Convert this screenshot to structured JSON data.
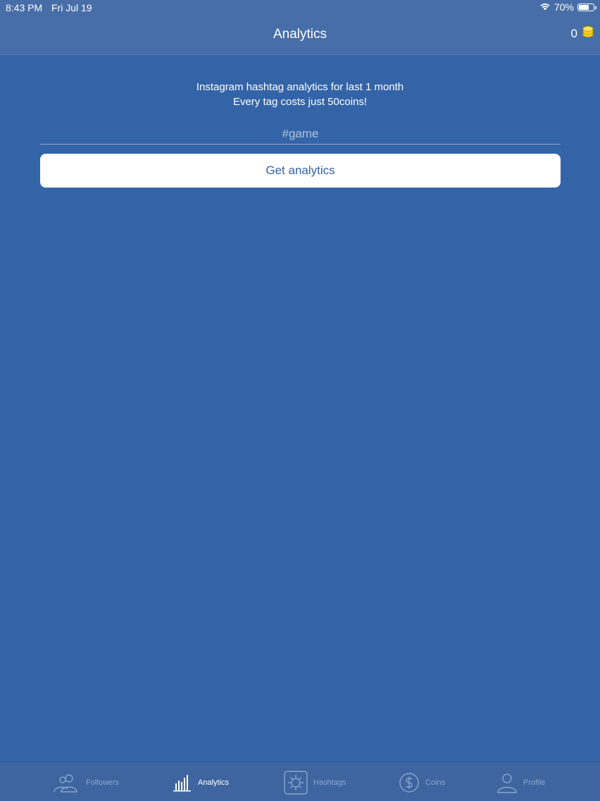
{
  "status_bar": {
    "time": "8:43 PM",
    "date": "Fri Jul 19",
    "battery_percent": "70%",
    "battery_level": 0.7
  },
  "nav": {
    "title": "Analytics",
    "coin_count": "0"
  },
  "content": {
    "line1": "Instagram hashtag analytics for last 1 month",
    "line2": "Every tag costs just 50coins!",
    "input_placeholder": "#game",
    "button_label": "Get analytics"
  },
  "tabs": [
    {
      "label": "Followers",
      "icon": "followers-icon",
      "active": false
    },
    {
      "label": "Analytics",
      "icon": "analytics-icon",
      "active": true
    },
    {
      "label": "Hashtags",
      "icon": "hashtags-icon",
      "active": false
    },
    {
      "label": "Coins",
      "icon": "coins-icon",
      "active": false
    },
    {
      "label": "Profile",
      "icon": "profile-icon",
      "active": false
    }
  ],
  "colors": {
    "background": "#3464a8",
    "bar": "#476ea8",
    "button_text": "#3464a8",
    "tab_inactive": "#8aa6d0",
    "coin": "#f5d31a"
  }
}
